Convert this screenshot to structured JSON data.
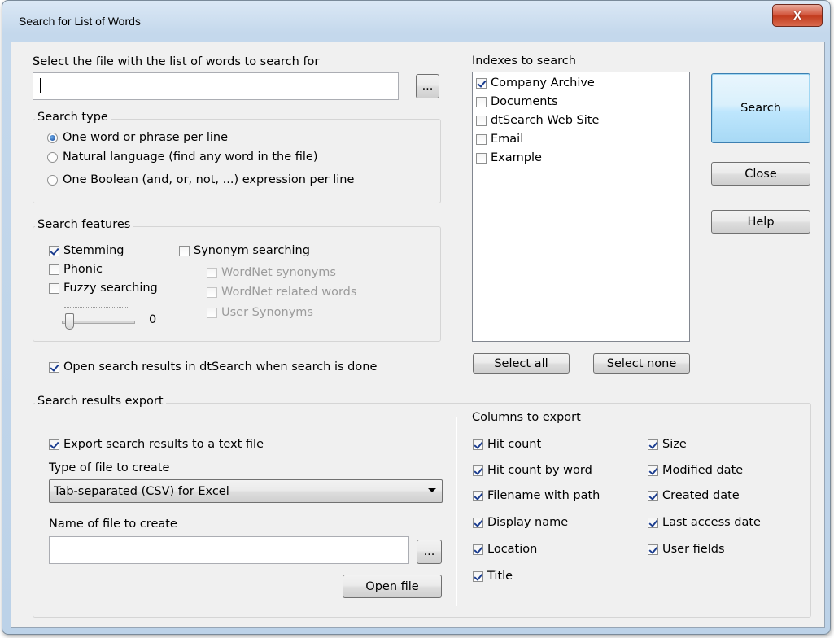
{
  "window": {
    "title": "Search for List of Words",
    "close_glyph": "X"
  },
  "file_section": {
    "label": "Select the file with the list of words to search for",
    "value": "",
    "browse_label": "..."
  },
  "search_type": {
    "label": "Search type",
    "options": [
      {
        "label": "One word or phrase per line",
        "selected": true
      },
      {
        "label": "Natural language (find any word in the file)",
        "selected": false
      },
      {
        "label": "One Boolean (and, or, not, ...) expression per line",
        "selected": false
      }
    ]
  },
  "search_features": {
    "label": "Search features",
    "stemming": {
      "label": "Stemming",
      "checked": true
    },
    "phonic": {
      "label": "Phonic",
      "checked": false
    },
    "fuzzy": {
      "label": "Fuzzy searching",
      "checked": false
    },
    "fuzzy_value": "0",
    "synonym": {
      "label": "Synonym searching",
      "checked": false
    },
    "wordnet_synonyms": {
      "label": "WordNet synonyms",
      "checked": false
    },
    "wordnet_related": {
      "label": "WordNet related words",
      "checked": false
    },
    "user_synonyms": {
      "label": "User Synonyms",
      "checked": false
    }
  },
  "open_results": {
    "label": "Open search results in dtSearch when search is done",
    "checked": true
  },
  "indexes": {
    "label": "Indexes to search",
    "items": [
      {
        "label": "Company Archive",
        "checked": true
      },
      {
        "label": "Documents",
        "checked": false
      },
      {
        "label": "dtSearch Web Site",
        "checked": false
      },
      {
        "label": "Email",
        "checked": false
      },
      {
        "label": "Example",
        "checked": false
      }
    ],
    "select_all": "Select all",
    "select_none": "Select none"
  },
  "buttons": {
    "search": "Search",
    "close": "Close",
    "help": "Help"
  },
  "export": {
    "label": "Search results export",
    "export_checkbox": {
      "label": "Export search results to a text file",
      "checked": true
    },
    "type_label": "Type of file to create",
    "type_value": "Tab-separated (CSV) for Excel",
    "name_label": "Name of file to create",
    "name_value": "",
    "browse_label": "...",
    "open_file": "Open file",
    "columns_label": "Columns to export",
    "columns_left": [
      {
        "label": "Hit count",
        "checked": true
      },
      {
        "label": "Hit count by word",
        "checked": true
      },
      {
        "label": "Filename with path",
        "checked": true
      },
      {
        "label": "Display name",
        "checked": true
      },
      {
        "label": "Location",
        "checked": true
      },
      {
        "label": "Title",
        "checked": true
      }
    ],
    "columns_right": [
      {
        "label": "Size",
        "checked": true
      },
      {
        "label": "Modified date",
        "checked": true
      },
      {
        "label": "Created date",
        "checked": true
      },
      {
        "label": "Last access date",
        "checked": true
      },
      {
        "label": "User fields",
        "checked": true
      }
    ]
  }
}
